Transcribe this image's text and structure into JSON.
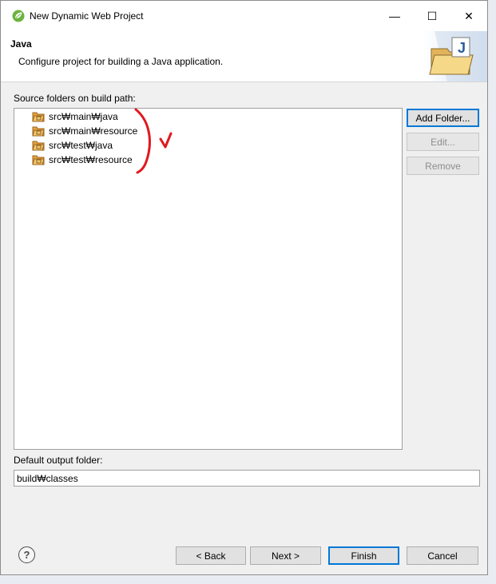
{
  "window": {
    "title": "New Dynamic Web Project",
    "minimize_glyph": "—",
    "maximize_glyph": "☐",
    "close_glyph": "✕"
  },
  "banner": {
    "title": "Java",
    "description": "Configure project for building a Java application."
  },
  "source_folders": {
    "label": "Source folders on build path:",
    "items": [
      {
        "label": "src₩main₩java"
      },
      {
        "label": "src₩main₩resource"
      },
      {
        "label": "src₩test₩java"
      },
      {
        "label": "src₩test₩resource"
      }
    ],
    "buttons": {
      "add_folder": "Add Folder...",
      "edit": "Edit...",
      "remove": "Remove"
    }
  },
  "output": {
    "label": "Default output folder:",
    "value": "build₩classes"
  },
  "footer": {
    "help_glyph": "?",
    "back": "< Back",
    "next": "Next >",
    "finish": "Finish",
    "cancel": "Cancel"
  },
  "colors": {
    "annotation_red": "#e0191e",
    "focus_blue": "#0078d7",
    "folder_orange": "#e8a23a"
  }
}
